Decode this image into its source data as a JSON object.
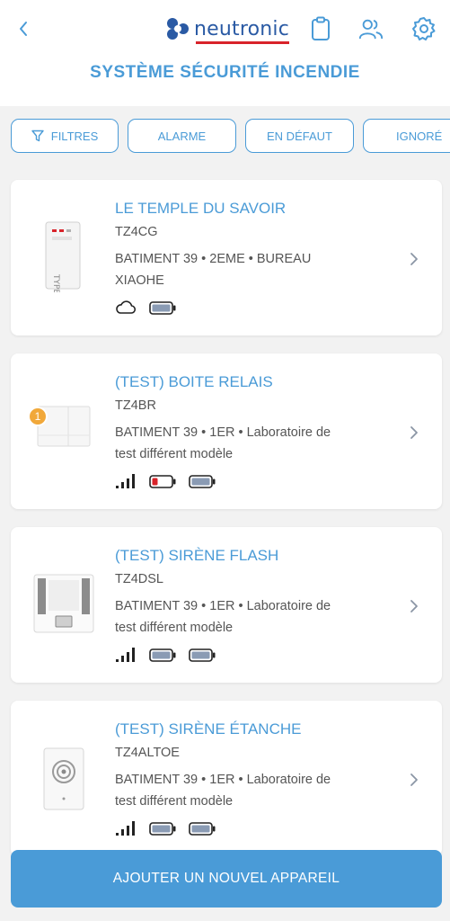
{
  "header": {
    "brand": "neutronic",
    "title": "SYSTÈME SÉCURITÉ INCENDIE"
  },
  "filters": [
    {
      "label": "FILTRES"
    },
    {
      "label": "ALARME"
    },
    {
      "label": "EN DÉFAUT"
    },
    {
      "label": "IGNORÉ"
    }
  ],
  "devices": [
    {
      "name": "LE TEMPLE DU SAVOIR",
      "code": "TZ4CG",
      "location_line1": "BATIMENT 39 • 2EME • BUREAU",
      "location_line2": "XIAOHE",
      "status_icons": [
        "cloud-icon",
        "battery-full-icon"
      ],
      "badge": ""
    },
    {
      "name": "(TEST) BOITE RELAIS",
      "code": "TZ4BR",
      "location_line1": "BATIMENT 39 • 1ER • Laboratoire de",
      "location_line2": "test différent modèle",
      "status_icons": [
        "signal-icon",
        "battery-low-icon",
        "battery-full-icon"
      ],
      "badge": "1"
    },
    {
      "name": "(TEST) SIRÈNE FLASH",
      "code": "TZ4DSL",
      "location_line1": "BATIMENT 39 • 1ER • Laboratoire de",
      "location_line2": "test différent modèle",
      "status_icons": [
        "signal-icon",
        "battery-full-icon",
        "battery-full-icon"
      ],
      "badge": ""
    },
    {
      "name": "(TEST) SIRÈNE ÉTANCHE",
      "code": "TZ4ALTOE",
      "location_line1": "BATIMENT 39 • 1ER • Laboratoire de",
      "location_line2": "test différent modèle",
      "status_icons": [
        "signal-icon",
        "battery-full-icon",
        "battery-full-icon"
      ],
      "badge": ""
    }
  ],
  "actions": {
    "add_device": "AJOUTER UN NOUVEL APPAREIL"
  },
  "colors": {
    "accent": "#4a9bd7",
    "brand_blue": "#2a5aa4",
    "brand_red": "#d8232a",
    "badge": "#f1a83a",
    "battery_low": "#d8232a",
    "battery_ok": "#8a9bb4"
  }
}
